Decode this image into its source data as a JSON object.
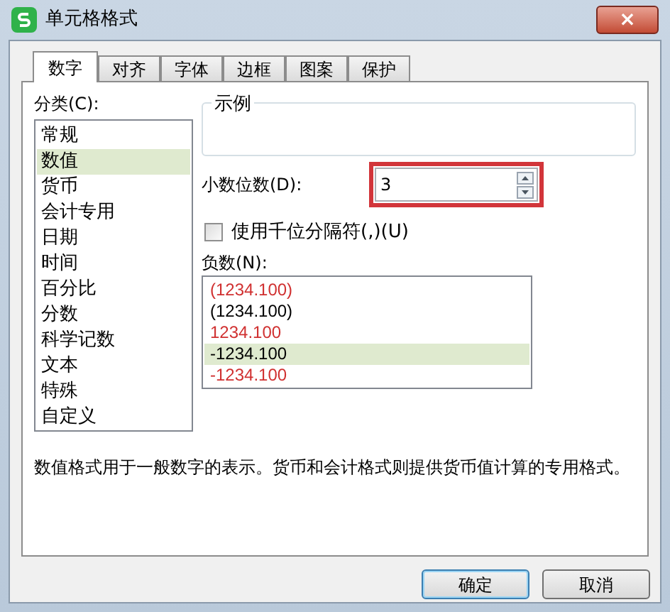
{
  "window": {
    "title": "单元格格式",
    "close": "×"
  },
  "tabs": [
    {
      "label": "数字",
      "selected": true
    },
    {
      "label": "对齐",
      "selected": false
    },
    {
      "label": "字体",
      "selected": false
    },
    {
      "label": "边框",
      "selected": false
    },
    {
      "label": "图案",
      "selected": false
    },
    {
      "label": "保护",
      "selected": false
    }
  ],
  "category": {
    "label": "分类(C):",
    "items": [
      {
        "label": "常规",
        "selected": false
      },
      {
        "label": "数值",
        "selected": true
      },
      {
        "label": "货币",
        "selected": false
      },
      {
        "label": "会计专用",
        "selected": false
      },
      {
        "label": "日期",
        "selected": false
      },
      {
        "label": "时间",
        "selected": false
      },
      {
        "label": "百分比",
        "selected": false
      },
      {
        "label": "分数",
        "selected": false
      },
      {
        "label": "科学记数",
        "selected": false
      },
      {
        "label": "文本",
        "selected": false
      },
      {
        "label": "特殊",
        "selected": false
      },
      {
        "label": "自定义",
        "selected": false
      }
    ]
  },
  "sample": {
    "label": "示例"
  },
  "decimal_places": {
    "label": "小数位数(D):",
    "value": "3",
    "highlighted": true
  },
  "thousands_separator": {
    "label": "使用千位分隔符(,)(U)",
    "checked": false
  },
  "negative_numbers": {
    "label": "负数(N):",
    "items": [
      {
        "label": "(1234.100)",
        "color": "#d03030",
        "selected": false
      },
      {
        "label": "(1234.100)",
        "color": "#000000",
        "selected": false
      },
      {
        "label": "1234.100",
        "color": "#d03030",
        "selected": false
      },
      {
        "label": "-1234.100",
        "color": "#000000",
        "selected": true
      },
      {
        "label": "-1234.100",
        "color": "#d03030",
        "selected": false
      }
    ]
  },
  "description": "数值格式用于一般数字的表示。货币和会计格式则提供货币值计算的专用格式。",
  "buttons": [
    {
      "label": "确定",
      "default": true
    },
    {
      "label": "取消",
      "default": false
    }
  ]
}
